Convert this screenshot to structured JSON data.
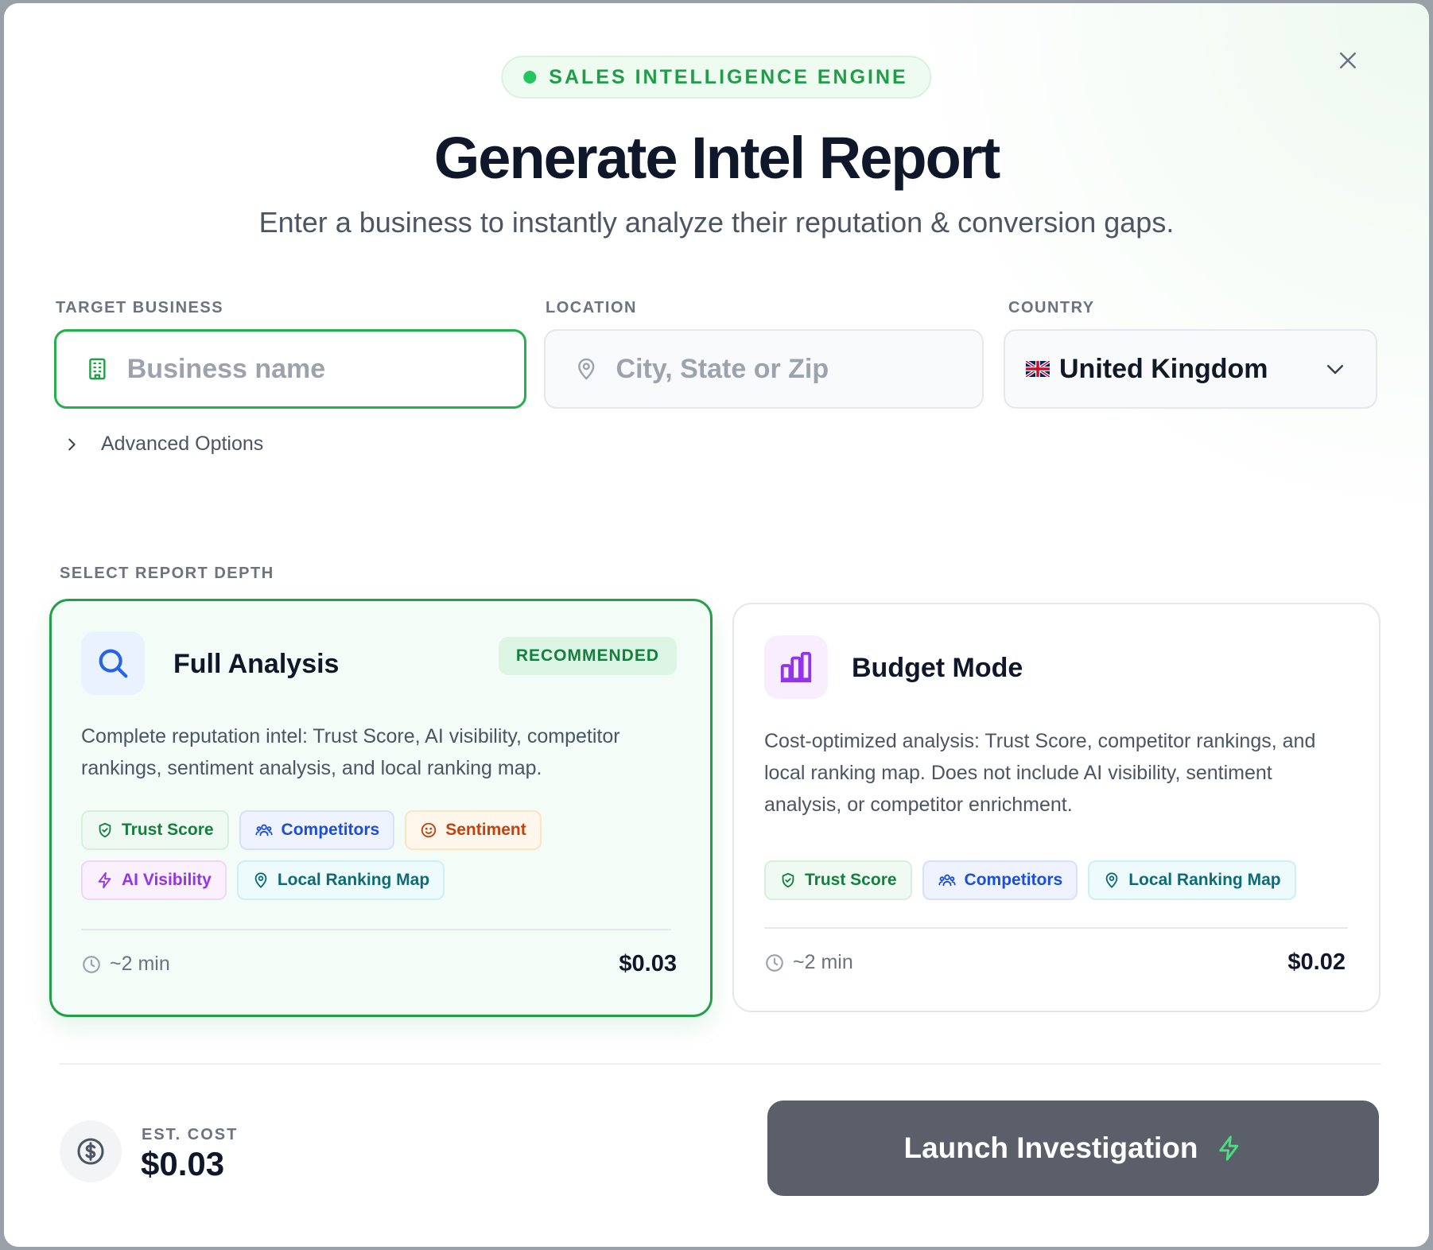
{
  "header": {
    "badge": "SALES INTELLIGENCE ENGINE",
    "title": "Generate Intel Report",
    "subtitle": "Enter a business to instantly analyze their reputation & conversion gaps."
  },
  "form": {
    "business": {
      "label": "TARGET BUSINESS",
      "placeholder": "Business name",
      "value": ""
    },
    "location": {
      "label": "LOCATION",
      "placeholder": "City, State or Zip",
      "value": ""
    },
    "country": {
      "label": "COUNTRY",
      "value": "United Kingdom",
      "flag": "uk-flag"
    },
    "advanced": "Advanced Options"
  },
  "depth": {
    "label": "SELECT REPORT DEPTH",
    "selected": "full",
    "options": [
      {
        "id": "full",
        "title": "Full Analysis",
        "badge": "RECOMMENDED",
        "description": "Complete reputation intel: Trust Score, AI visibility, competitor rankings, sentiment analysis, and local ranking map.",
        "tags": [
          "Trust Score",
          "Competitors",
          "Sentiment",
          "AI Visibility",
          "Local Ranking Map"
        ],
        "time": "~2 min",
        "price": "$0.03",
        "icon": "search-icon"
      },
      {
        "id": "budget",
        "title": "Budget Mode",
        "description": "Cost-optimized analysis: Trust Score, competitor rankings, and local ranking map. Does not include AI visibility, sentiment analysis, or competitor enrichment.",
        "tags": [
          "Trust Score",
          "Competitors",
          "Local Ranking Map"
        ],
        "time": "~2 min",
        "price": "$0.02",
        "icon": "bar-chart-icon"
      }
    ]
  },
  "footer": {
    "cost_label": "EST. COST",
    "cost_value": "$0.03",
    "launch_label": "Launch Investigation"
  },
  "colors": {
    "accent": "#22a046",
    "button": "#5a5f69",
    "heading": "#0f172a"
  }
}
